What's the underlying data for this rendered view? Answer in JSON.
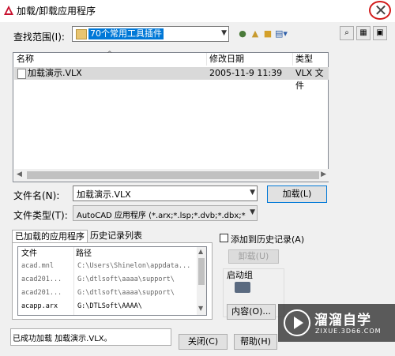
{
  "window": {
    "title": "加载/卸载应用程序",
    "close_icon": "close-icon"
  },
  "lookin": {
    "label": "查找范围(I):",
    "value": "70个常用工具插件"
  },
  "toolbar": {
    "icons": [
      "back-icon",
      "up-folder-icon",
      "new-folder-icon",
      "views-icon"
    ],
    "right_buttons": [
      "find-icon",
      "tools-icon",
      "preview-icon"
    ]
  },
  "file_list": {
    "columns": [
      "名称",
      "修改日期",
      "类型"
    ],
    "rows": [
      {
        "name": "加载演示.VLX",
        "date": "2005-11-9 11:39",
        "type": "VLX 文件"
      }
    ]
  },
  "filename": {
    "label": "文件名(N):",
    "value": "加载演示.VLX"
  },
  "filetype": {
    "label": "文件类型(T):",
    "value": "AutoCAD 应用程序 (*.arx;*.lsp;*.dvb;*.dbx;*.vlx"
  },
  "load_button": "加载(L)",
  "tabs": [
    "已加载的应用程序",
    "历史记录列表"
  ],
  "loaded_apps": {
    "columns": [
      "文件",
      "路径"
    ],
    "rows": [
      {
        "file": "acad.mnl",
        "path": "C:\\Users\\Shinelon\\appdata...",
        "dim": true
      },
      {
        "file": "acad201...",
        "path": "G:\\dtlsoft\\aaaa\\support\\",
        "dim": true
      },
      {
        "file": "acad201...",
        "path": "G:\\dtlsoft\\aaaa\\support\\",
        "dim": true
      },
      {
        "file": "acapp.arx",
        "path": "G:\\DTLSoft\\AAAA\\",
        "dim": false
      }
    ]
  },
  "history_checkbox": "添加到历史记录(A)",
  "unload_button": "卸载(U)",
  "startup": {
    "label": "启动组",
    "contents_button": "内容(O)..."
  },
  "status": "已成功加载 加载演示.VLX。",
  "close_button": "关闭(C)",
  "help_button": "帮助(H)",
  "watermark": {
    "name": "溜溜自学",
    "url": "ZIXUE.3D66.COM"
  }
}
